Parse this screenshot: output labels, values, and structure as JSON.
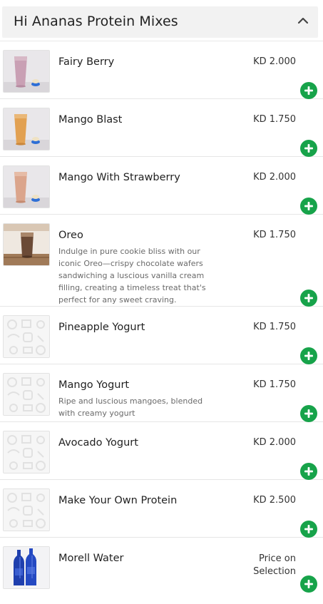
{
  "section": {
    "title": "Hi Ananas Protein Mixes",
    "collapse_icon": "chevron-up-icon"
  },
  "colors": {
    "accent_green": "#17a34a",
    "header_bg": "#f2f2f2",
    "description_text": "#6a6a6a"
  },
  "items": [
    {
      "name": "Fairy Berry",
      "price": "KD 2.000",
      "description": "",
      "image": "pink-protein-shake-photo"
    },
    {
      "name": "Mango Blast",
      "price": "KD 1.750",
      "description": "",
      "image": "mango-protein-shake-photo"
    },
    {
      "name": "Mango With Strawberry",
      "price": "KD 2.000",
      "description": "",
      "image": "peach-protein-shake-photo"
    },
    {
      "name": "Oreo",
      "price": "KD 1.750",
      "description": "Indulge in pure cookie bliss with our iconic Oreo—crispy chocolate wafers sandwiching a luscious vanilla cream filling, creating a timeless treat that's perfect for any sweet craving.",
      "image": "chocolate-shake-photo"
    },
    {
      "name": "Pineapple Yogurt",
      "price": "KD 1.750",
      "description": "",
      "image": "placeholder-food-pattern"
    },
    {
      "name": "Mango Yogurt",
      "price": "KD 1.750",
      "description": "Ripe and luscious mangoes, blended with creamy yogurt",
      "image": "placeholder-food-pattern"
    },
    {
      "name": "Avocado Yogurt",
      "price": "KD 2.000",
      "description": "",
      "image": "placeholder-food-pattern"
    },
    {
      "name": "Make Your Own Protein",
      "price": "KD 2.500",
      "description": "",
      "image": "placeholder-food-pattern"
    },
    {
      "name": "Morell Water",
      "price": "Price on Selection",
      "description": "",
      "image": "blue-water-bottles-photo"
    }
  ],
  "add_button_icon": "plus-icon"
}
